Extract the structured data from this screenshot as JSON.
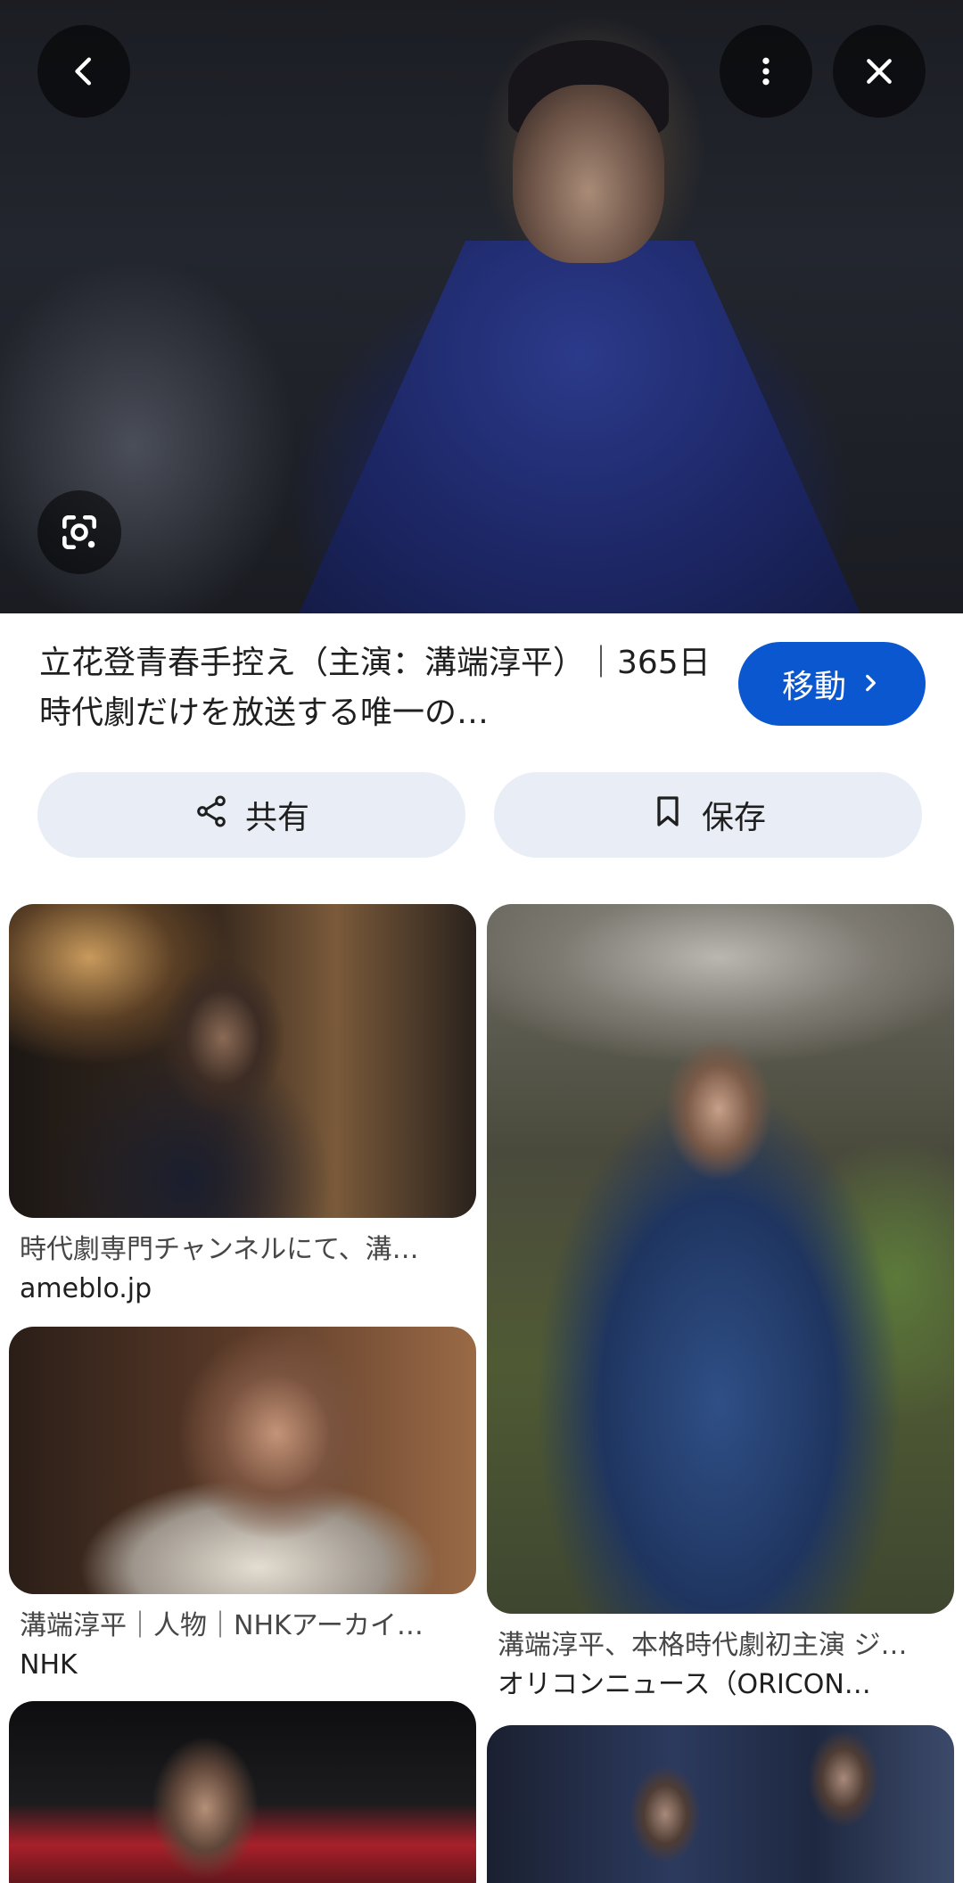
{
  "viewer": {
    "back_icon": "arrow-back-icon",
    "more_icon": "more-vert-icon",
    "close_icon": "close-icon",
    "lens_icon": "lens-icon"
  },
  "result": {
    "title": "立花登青春手控え（主演：溝端淳平）｜365日時代劇だけを放送する唯一の…",
    "visit_label": "移動",
    "visit_icon": "chevron-right-icon",
    "share_label": "共有",
    "share_icon": "share-icon",
    "save_label": "保存",
    "save_icon": "bookmark-icon"
  },
  "related": [
    {
      "caption": "時代劇専門チャンネルにて、溝…",
      "source": "ameblo.jp"
    },
    {
      "caption": "溝端淳平、本格時代劇初主演 ジ…",
      "source": "オリコンニュース（ORICON…"
    },
    {
      "caption": "溝端淳平｜人物｜NHKアーカイ…",
      "source": "NHK"
    }
  ],
  "colors": {
    "accent": "#0b57d0",
    "chip_bg": "#e9eef6",
    "text": "#1f1f1f",
    "muted": "#474747"
  }
}
